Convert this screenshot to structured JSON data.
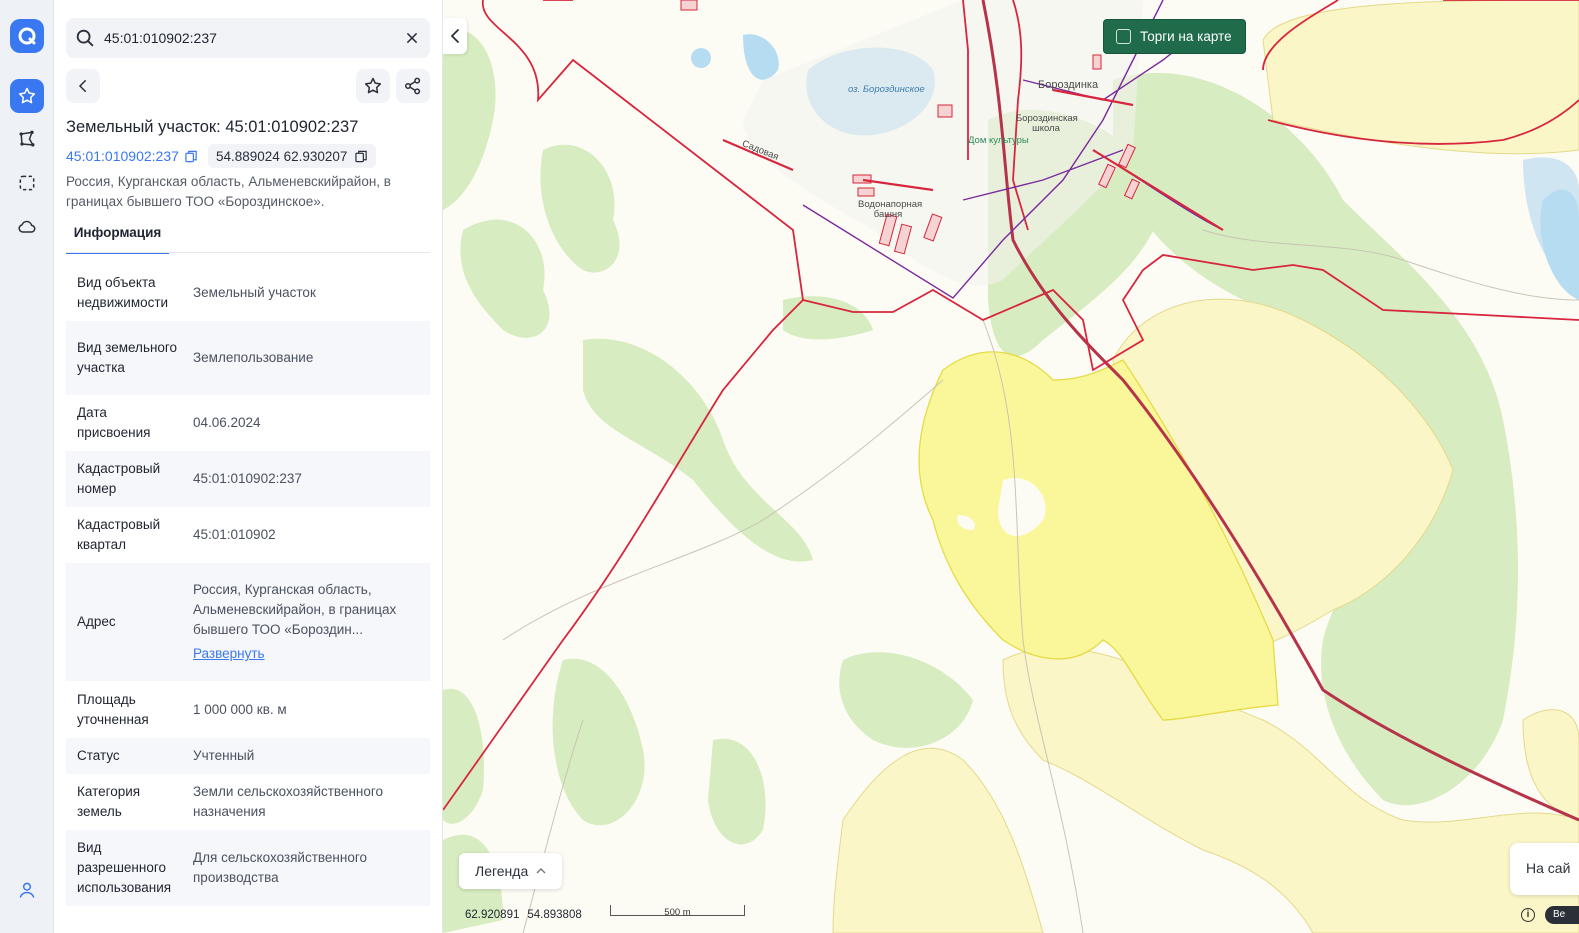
{
  "search": {
    "value": "45:01:010902:237"
  },
  "parcel": {
    "title": "Земельный участок: 45:01:010902:237",
    "cadastral_link": "45:01:010902:237",
    "coordinates": "54.889024 62.930207",
    "address": "Россия, Курганская область, Альменевскийрайон, в границах бывшего ТОО «Бороздинское»."
  },
  "tabs": [
    {
      "label": "Информация",
      "active": true
    }
  ],
  "info_rows": [
    {
      "key": "Вид объекта недвижимости",
      "value": "Земельный участок"
    },
    {
      "key": "Вид земельного участка",
      "value": "Землепользование"
    },
    {
      "key": "Дата присвоения",
      "value": "04.06.2024"
    },
    {
      "key": "Кадастровый номер",
      "value": "45:01:010902:237"
    },
    {
      "key": "Кадастровый квартал",
      "value": "45:01:010902"
    },
    {
      "key": "Адрес",
      "value": "Россия, Курганская область, Альменевскийрайон, в границах бывшего ТОО «Бороздин...",
      "link": "Развернуть"
    },
    {
      "key": "Площадь уточненная",
      "value": "1 000 000 кв. м"
    },
    {
      "key": "Статус",
      "value": "Учтенный"
    },
    {
      "key": "Категория земель",
      "value": "Земли сельскохозяйственного назначения"
    },
    {
      "key": "Вид разрешенного использования",
      "value": "Для сельскохозяйственного производства"
    }
  ],
  "map": {
    "torgi_label": "Торги на карте",
    "legend_label": "Легенда",
    "cursor_lon": "62.920891",
    "cursor_lat": "54.893808",
    "scale_label": "500 m",
    "na_sai_label": "На сай",
    "be_label": "Ве",
    "info_icon_label": "i",
    "labels": {
      "lake": "оз. Бороздинское",
      "village": "Бороздинка",
      "school": "Бороздинская школа",
      "culture": "Дом культуры",
      "tower": "Водонапорная башня",
      "street": "Садовая"
    }
  },
  "colors": {
    "accent": "#3a78f2",
    "boundary": "#d7263d",
    "forest": "#d7ecc0",
    "selected_parcel": "#faf79a",
    "torgi_button": "#1f6b4a"
  },
  "icons": [
    "logo-icon",
    "star-icon",
    "polygon-icon",
    "selection-icon",
    "cloud-icon",
    "user-icon",
    "search-icon",
    "close-icon",
    "back-icon",
    "share-icon",
    "copy-icon",
    "chevron-left-icon",
    "chevron-up-icon"
  ]
}
